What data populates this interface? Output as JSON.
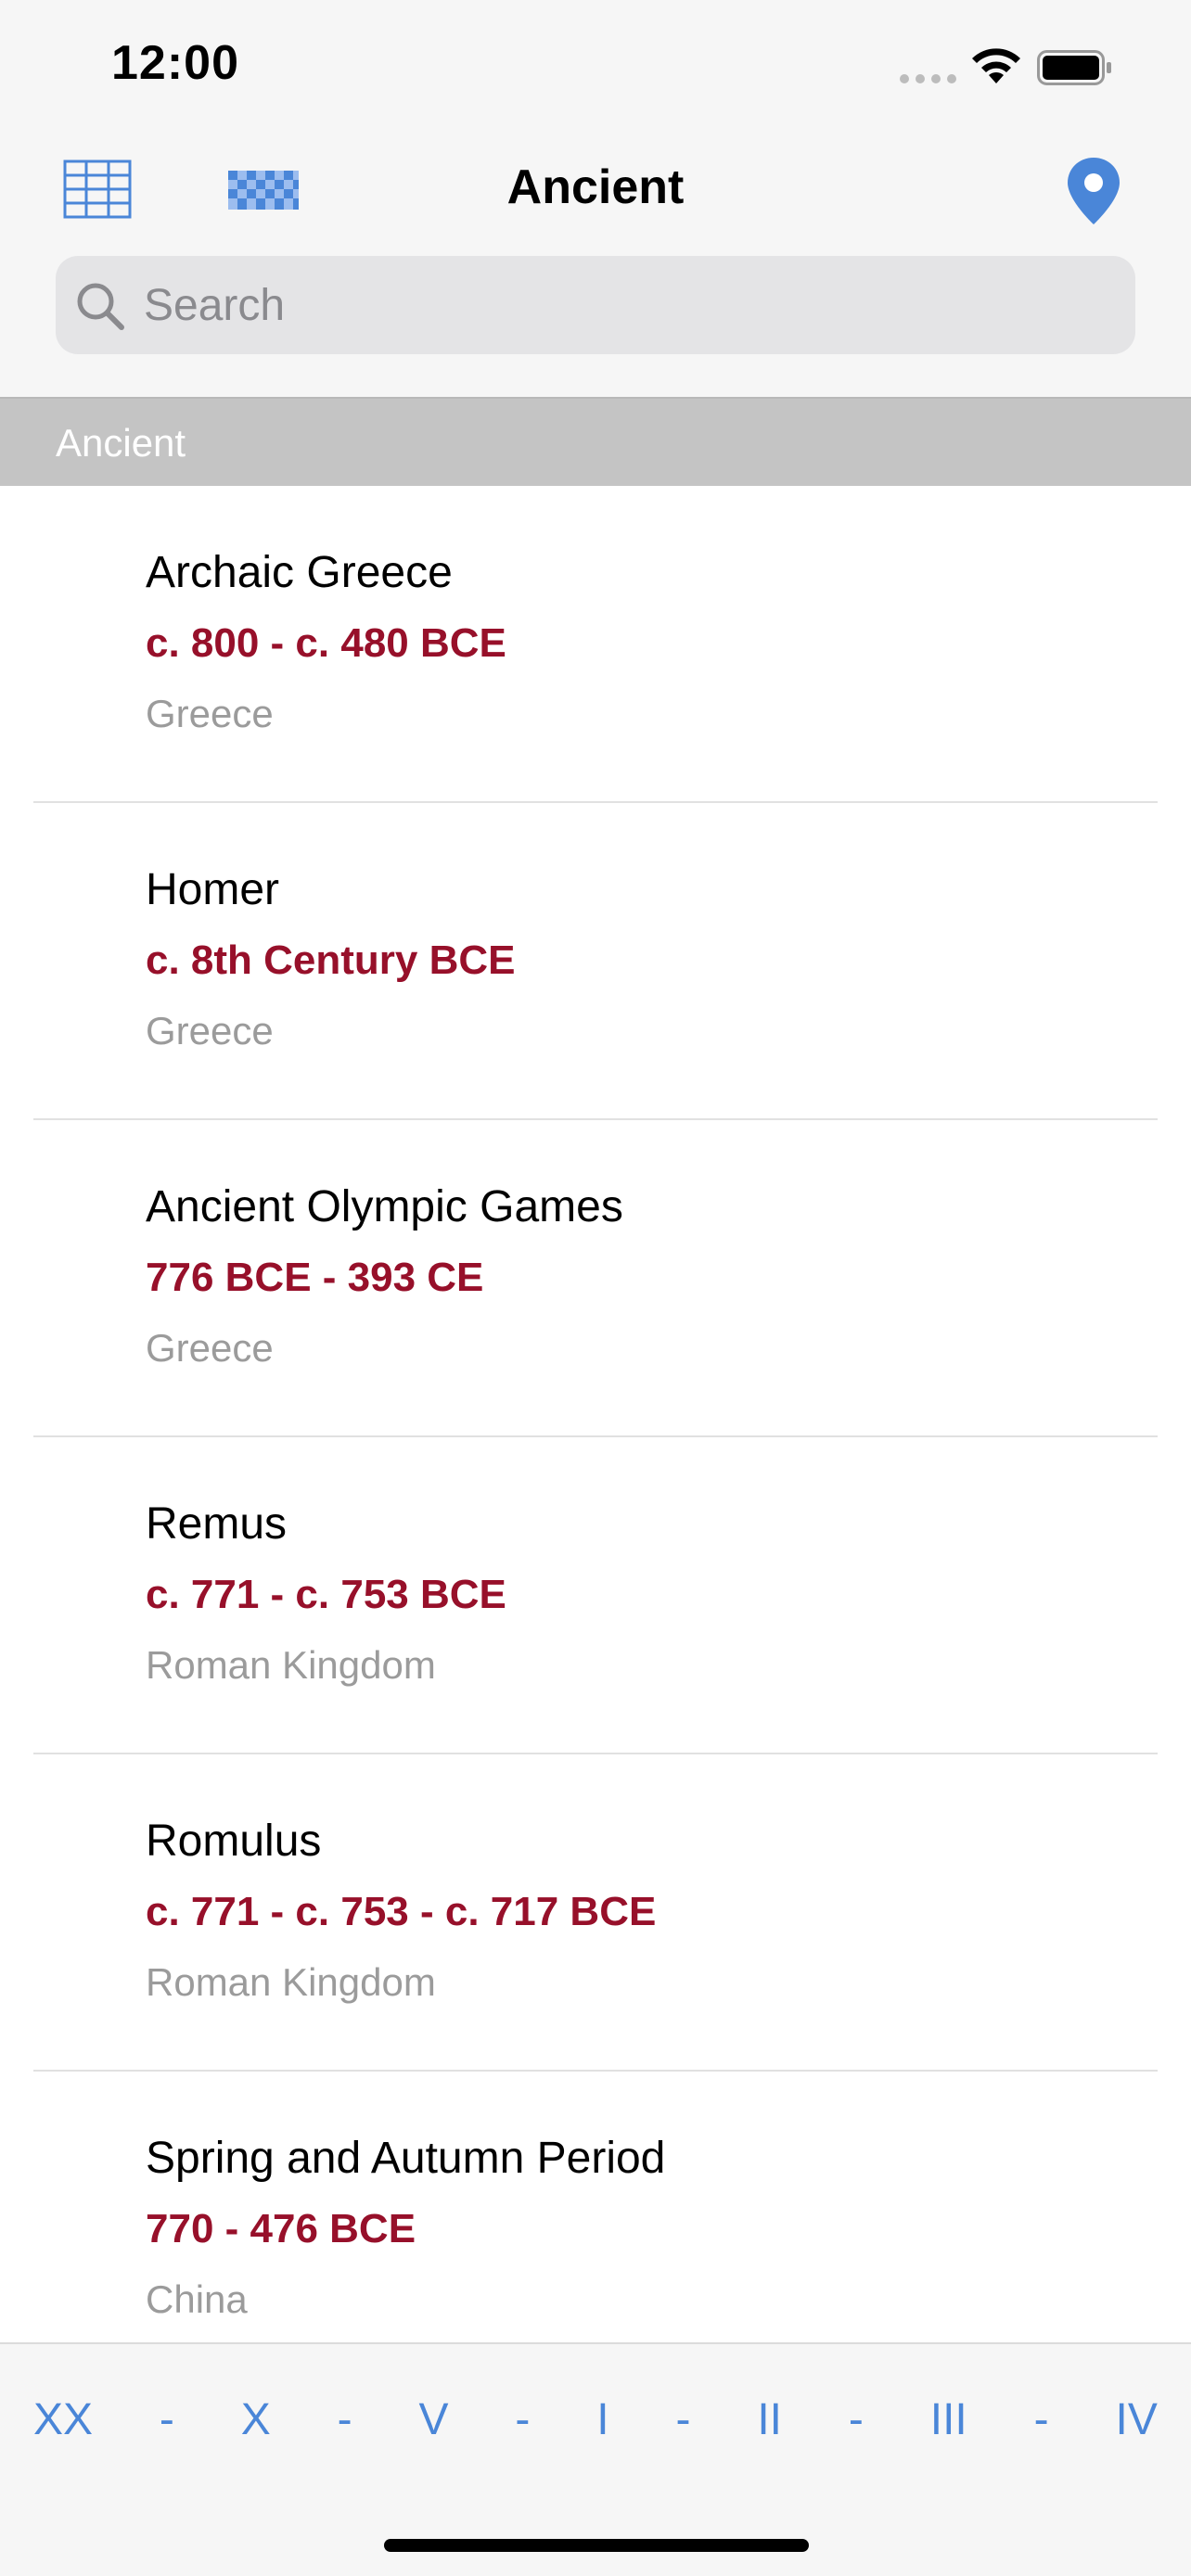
{
  "status_bar": {
    "time": "12:00"
  },
  "nav": {
    "title": "Ancient"
  },
  "search": {
    "placeholder": "Search",
    "value": ""
  },
  "section": {
    "title": "Ancient"
  },
  "items": [
    {
      "name": "Archaic Greece",
      "dates": "c. 800 - c. 480 BCE",
      "place": "Greece"
    },
    {
      "name": "Homer",
      "dates": "c. 8th Century BCE",
      "place": "Greece"
    },
    {
      "name": "Ancient Olympic Games",
      "dates": "776 BCE - 393 CE",
      "place": "Greece"
    },
    {
      "name": "Remus",
      "dates": "c. 771 - c. 753 BCE",
      "place": "Roman Kingdom"
    },
    {
      "name": "Romulus",
      "dates": "c. 771 - c. 753 - c. 717 BCE",
      "place": "Roman Kingdom"
    },
    {
      "name": "Spring and Autumn Period",
      "dates": "770 - 476 BCE",
      "place": "China"
    }
  ],
  "index": [
    "XX",
    "-",
    "X",
    "-",
    "V",
    "-",
    "I",
    "-",
    "II",
    "-",
    "III",
    "-",
    "IV"
  ],
  "colors": {
    "accent": "#4a86d8",
    "dates": "#97102a",
    "section_header": "#c4c4c4"
  },
  "icons": [
    "grid-icon",
    "checker-pattern-icon",
    "map-pin-icon",
    "search-icon",
    "wifi-icon",
    "battery-icon",
    "signal-icon"
  ]
}
